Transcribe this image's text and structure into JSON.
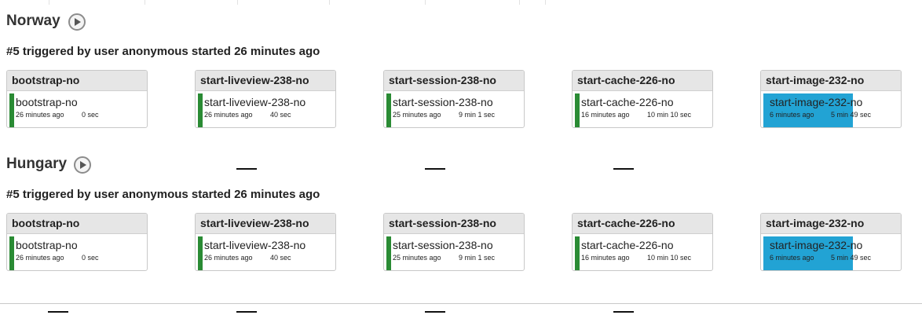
{
  "pipelines": [
    {
      "title": "Norway",
      "run": "#5 triggered by user anonymous started 26 minutes ago",
      "stages": [
        {
          "header": "bootstrap-no",
          "job": "bootstrap-no",
          "started": "26 minutes ago",
          "duration": "0 sec",
          "status": "success"
        },
        {
          "header": "start-liveview-238-no",
          "job": "start-liveview-238-no",
          "started": "26 minutes ago",
          "duration": "40 sec",
          "status": "success"
        },
        {
          "header": "start-session-238-no",
          "job": "start-session-238-no",
          "started": "25 minutes ago",
          "duration": "9 min 1 sec",
          "status": "success"
        },
        {
          "header": "start-cache-226-no",
          "job": "start-cache-226-no",
          "started": "16 minutes ago",
          "duration": "10 min 10 sec",
          "status": "success"
        },
        {
          "header": "start-image-232-no",
          "job": "start-image-232-no",
          "started": "6 minutes ago",
          "duration": "5 min 49 sec",
          "status": "running"
        }
      ]
    },
    {
      "title": "Hungary",
      "run": "#5 triggered by user anonymous started 26 minutes ago",
      "stages": [
        {
          "header": "bootstrap-no",
          "job": "bootstrap-no",
          "started": "26 minutes ago",
          "duration": "0 sec",
          "status": "success"
        },
        {
          "header": "start-liveview-238-no",
          "job": "start-liveview-238-no",
          "started": "26 minutes ago",
          "duration": "40 sec",
          "status": "success"
        },
        {
          "header": "start-session-238-no",
          "job": "start-session-238-no",
          "started": "25 minutes ago",
          "duration": "9 min 1 sec",
          "status": "success"
        },
        {
          "header": "start-cache-226-no",
          "job": "start-cache-226-no",
          "started": "16 minutes ago",
          "duration": "10 min 10 sec",
          "status": "success"
        },
        {
          "header": "start-image-232-no",
          "job": "start-image-232-no",
          "started": "6 minutes ago",
          "duration": "5 min 49 sec",
          "status": "running"
        }
      ]
    }
  ],
  "colors": {
    "success": "#2a8b34",
    "running": "#22a3d4"
  },
  "icons": {
    "run": "play-icon"
  }
}
